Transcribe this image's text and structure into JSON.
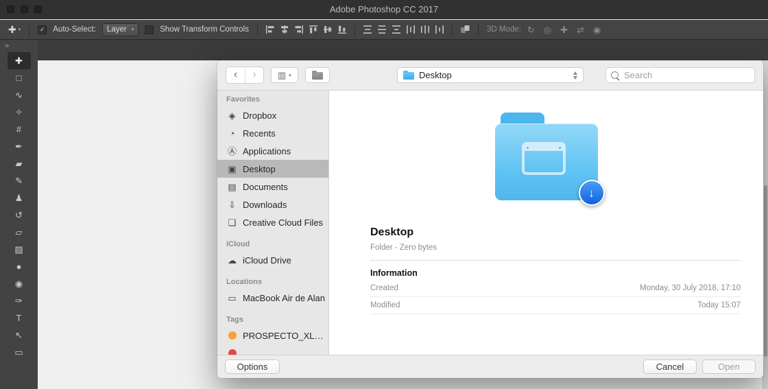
{
  "window": {
    "title": "Adobe Photoshop CC 2017"
  },
  "options_bar": {
    "move_tool_glyph": "✚",
    "preset_caret": "▾",
    "auto_select_label": "Auto-Select:",
    "auto_select_checked": "✓",
    "layer_value": "Layer",
    "layer_caret": "▾",
    "show_transform_label": "Show Transform Controls",
    "mode_3d_label": "3D Mode:",
    "mode_3d_icons": [
      {
        "name": "3d-orbit-icon",
        "glyph": "↻"
      },
      {
        "name": "3d-roll-icon",
        "glyph": "◎"
      },
      {
        "name": "3d-pan-icon",
        "glyph": "✚"
      },
      {
        "name": "3d-slide-icon",
        "glyph": "⇄"
      },
      {
        "name": "3d-camera-icon",
        "glyph": "◉"
      }
    ]
  },
  "toolbar": {
    "expand_glyph": "»",
    "tools": [
      {
        "name": "move",
        "glyph": "✚"
      },
      {
        "name": "rectangular-marquee",
        "glyph": "□"
      },
      {
        "name": "lasso",
        "glyph": "∿"
      },
      {
        "name": "quick-selection",
        "glyph": "✧"
      },
      {
        "name": "crop",
        "glyph": "#"
      },
      {
        "name": "eyedropper",
        "glyph": "✒"
      },
      {
        "name": "spot-healing-brush",
        "glyph": "▰"
      },
      {
        "name": "brush",
        "glyph": "✎"
      },
      {
        "name": "clone-stamp",
        "glyph": "♟"
      },
      {
        "name": "history-brush",
        "glyph": "↺"
      },
      {
        "name": "eraser",
        "glyph": "▱"
      },
      {
        "name": "gradient",
        "glyph": "▨"
      },
      {
        "name": "blur",
        "glyph": "●"
      },
      {
        "name": "dodge",
        "glyph": "◉"
      },
      {
        "name": "pen",
        "glyph": "✑"
      },
      {
        "name": "type",
        "glyph": "T"
      },
      {
        "name": "path-selection",
        "glyph": "↖"
      },
      {
        "name": "rectangle",
        "glyph": "▭"
      }
    ]
  },
  "dialog": {
    "toolbar": {
      "back_glyph": "‹",
      "forward_glyph": "›",
      "view_glyph": "▥",
      "view_caret": "▾",
      "location_value": "Desktop",
      "search_placeholder": "Search"
    },
    "sidebar": {
      "sections": [
        {
          "title": "Favorites",
          "items": [
            {
              "label": "Dropbox",
              "glyph": "◈"
            },
            {
              "label": "Recents",
              "glyph": "◔"
            },
            {
              "label": "Applications",
              "glyph": "Ⓐ"
            },
            {
              "label": "Desktop",
              "glyph": "▣",
              "selected": true
            },
            {
              "label": "Documents",
              "glyph": "▤"
            },
            {
              "label": "Downloads",
              "glyph": "⇩"
            },
            {
              "label": "Creative Cloud Files",
              "glyph": "❏"
            }
          ]
        },
        {
          "title": "iCloud",
          "items": [
            {
              "label": "iCloud Drive",
              "glyph": "☁"
            }
          ]
        },
        {
          "title": "Locations",
          "items": [
            {
              "label": "MacBook Air de Alan",
              "glyph": "▭"
            }
          ]
        },
        {
          "title": "Tags",
          "items": [
            {
              "label": "PROSPECTO_XLABS...",
              "dot_color": "#f7a23b"
            },
            {
              "label": "",
              "dot_color": "#e8493c"
            }
          ]
        }
      ]
    },
    "preview": {
      "title": "Desktop",
      "subtitle": "Folder - Zero bytes",
      "info_heading": "Information",
      "badge_arrow": "↓",
      "rows": [
        {
          "label": "Created",
          "value": "Monday, 30 July 2018, 17:10"
        },
        {
          "label": "Modified",
          "value": "Today 15:07"
        }
      ]
    },
    "footer": {
      "options_label": "Options",
      "cancel_label": "Cancel",
      "open_label": "Open"
    }
  },
  "colors": {
    "folder_blue": "#58bff2",
    "badge_blue": "#1a6ae4",
    "tag_orange": "#f7a23b",
    "tag_red": "#e8493c",
    "sidebar_selected": "#b9b9b9"
  }
}
